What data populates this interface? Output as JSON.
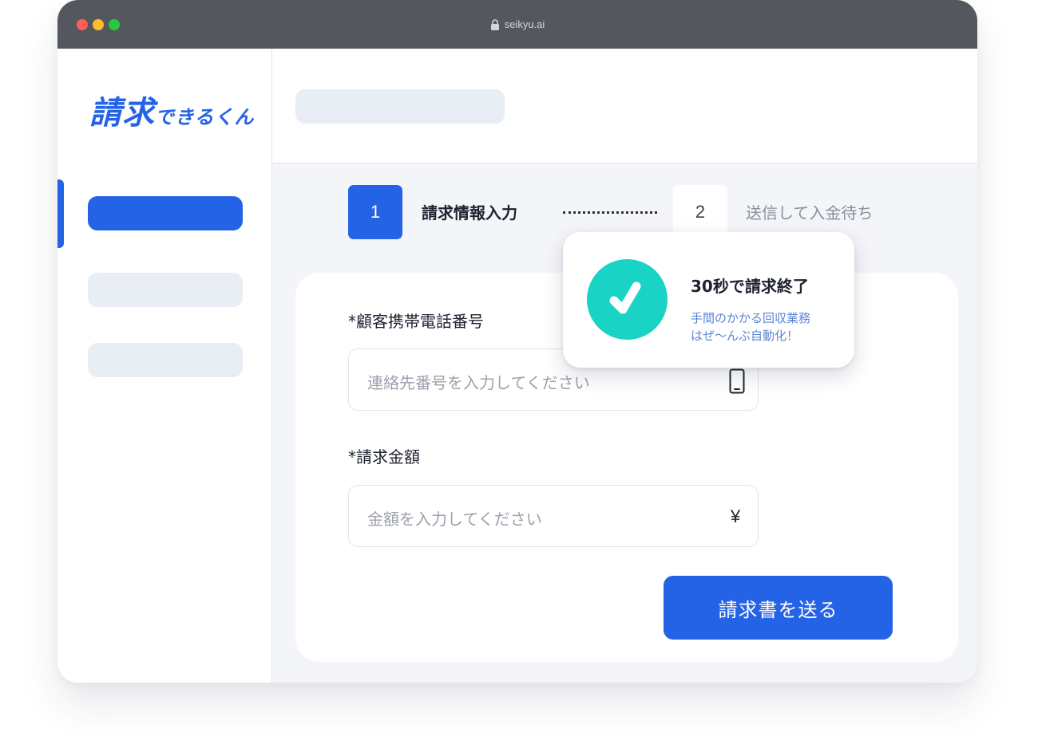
{
  "browser": {
    "url": "seikyu.ai"
  },
  "app": {
    "logo_main": "請求",
    "logo_rest": "できるくん"
  },
  "steps": [
    {
      "number": "1",
      "label": "請求情報入力"
    },
    {
      "number": "2",
      "label": "送信して入金待ち"
    }
  ],
  "form": {
    "phone_label": "*顧客携帯電話番号",
    "phone_placeholder": "連絡先番号を入力してください",
    "amount_label": "*請求金額",
    "amount_placeholder": "金額を入力してください",
    "currency_symbol": "¥",
    "submit_label": "請求書を送る"
  },
  "toast": {
    "title": "30秒で請求終了",
    "line1": "手間のかかる回収業務",
    "line2": "はぜ〜んぶ自動化！"
  },
  "colors": {
    "accent": "#2563e6",
    "success": "#19d3c5",
    "titlebar": "#54575e"
  }
}
